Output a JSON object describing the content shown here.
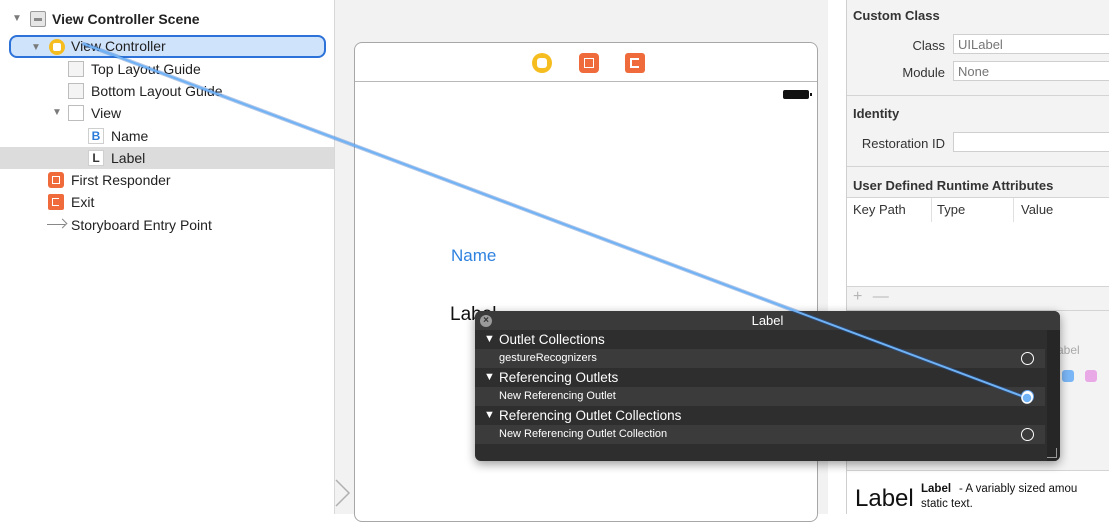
{
  "outline": {
    "scene_title": "View Controller Scene",
    "items": [
      {
        "label": "View Controller"
      },
      {
        "label": "Top Layout Guide"
      },
      {
        "label": "Bottom Layout Guide"
      },
      {
        "label": "View"
      },
      {
        "label": "Name",
        "badge": "B"
      },
      {
        "label": "Label",
        "badge": "L"
      },
      {
        "label": "First Responder"
      },
      {
        "label": "Exit"
      },
      {
        "label": "Storyboard Entry Point"
      }
    ]
  },
  "canvas": {
    "name_button": "Name",
    "label_text": "Label"
  },
  "inspector": {
    "custom_class": {
      "heading": "Custom Class",
      "class_label": "Class",
      "class_placeholder": "UILabel",
      "module_label": "Module",
      "module_placeholder": "None"
    },
    "identity": {
      "heading": "Identity",
      "restoration_label": "Restoration ID"
    },
    "udra": {
      "heading": "User Defined Runtime Attributes",
      "columns": [
        "Key Path",
        "Type",
        "Value"
      ],
      "add": "+",
      "remove": "—"
    },
    "peek_text": "abel",
    "library": {
      "big": "Label",
      "title": "Label",
      "desc": "- A variably sized amou",
      "desc2": "static text."
    }
  },
  "popup": {
    "title": "Label",
    "close": "×",
    "sections": [
      {
        "title": "Outlet Collections",
        "items": [
          {
            "label": "gestureRecognizers",
            "connected": false
          }
        ]
      },
      {
        "title": "Referencing Outlets",
        "items": [
          {
            "label": "New Referencing Outlet",
            "connected": true
          }
        ]
      },
      {
        "title": "Referencing Outlet Collections",
        "items": [
          {
            "label": "New Referencing Outlet Collection",
            "connected": false
          }
        ]
      }
    ]
  },
  "colors": {
    "selection_blue": "#2d72d9",
    "drag_line": "#5ba4f0",
    "vc_yellow": "#f5bd1f",
    "orange": "#ef6b3b",
    "link_blue": "#2f82e0"
  }
}
